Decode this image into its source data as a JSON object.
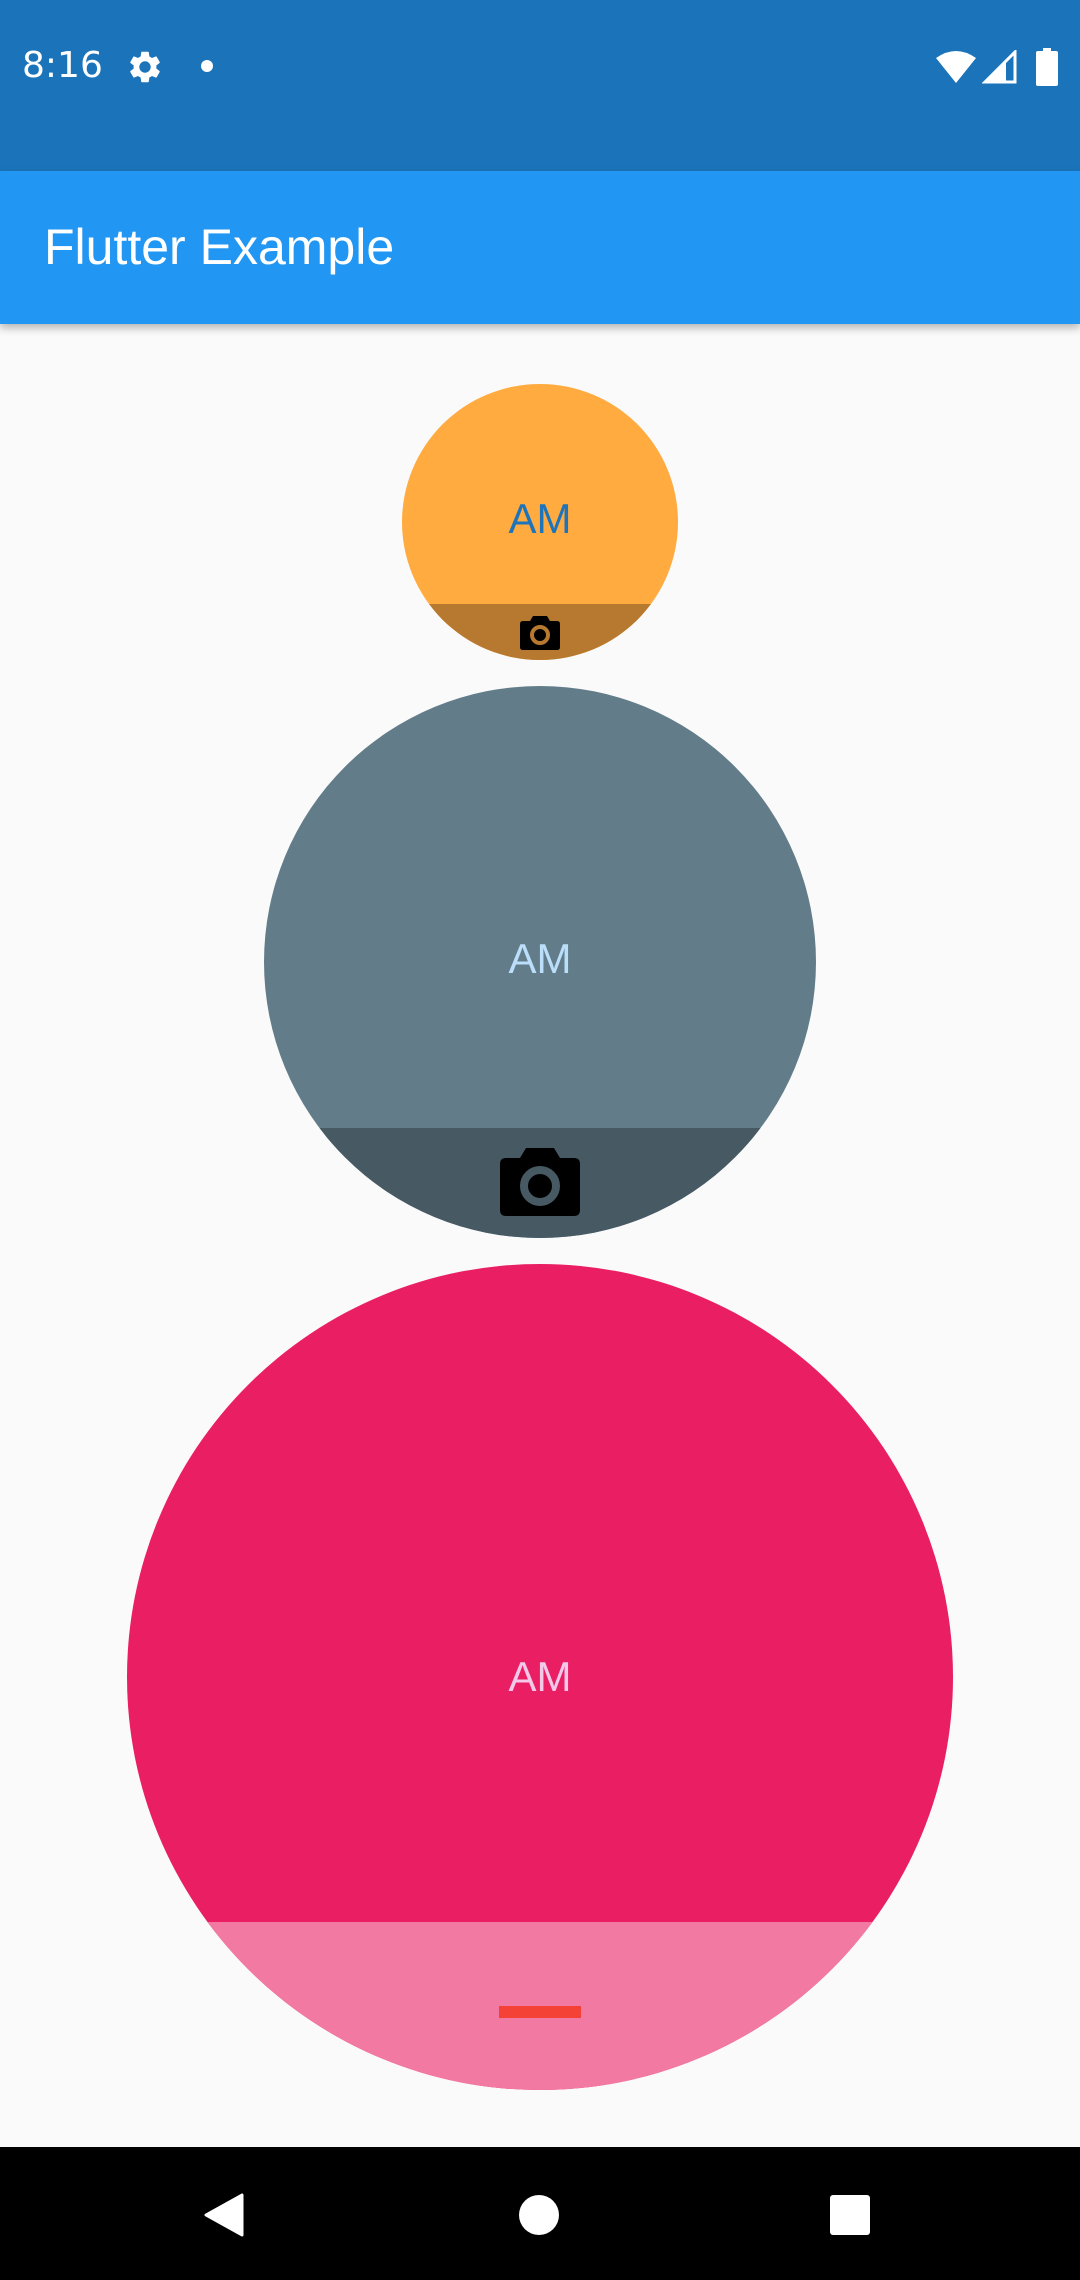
{
  "status_bar": {
    "time": "8:16",
    "icons": [
      "gear-icon",
      "notification-dot-icon",
      "wifi-icon",
      "signal-icon",
      "battery-icon"
    ]
  },
  "app_bar": {
    "title": "Flutter Example",
    "color": "#2196f3"
  },
  "avatars": [
    {
      "initials": "AM",
      "background": "#ffab40",
      "initials_color": "#1e74ba",
      "bottom_color": "#b7792f",
      "bottom_icon": "camera-icon"
    },
    {
      "initials": "AM",
      "background": "#627d89",
      "initials_color": "#bbdefb",
      "bottom_color": "#475a64",
      "bottom_icon": "camera-icon"
    },
    {
      "initials": "AM",
      "background": "#e91e63",
      "initials_color": "#f3c8e8",
      "bottom_color": "#f279a1",
      "bottom_icon": "remove-icon"
    }
  ],
  "nav_bar": {
    "icons": [
      "back-icon",
      "home-icon",
      "recents-icon"
    ]
  }
}
